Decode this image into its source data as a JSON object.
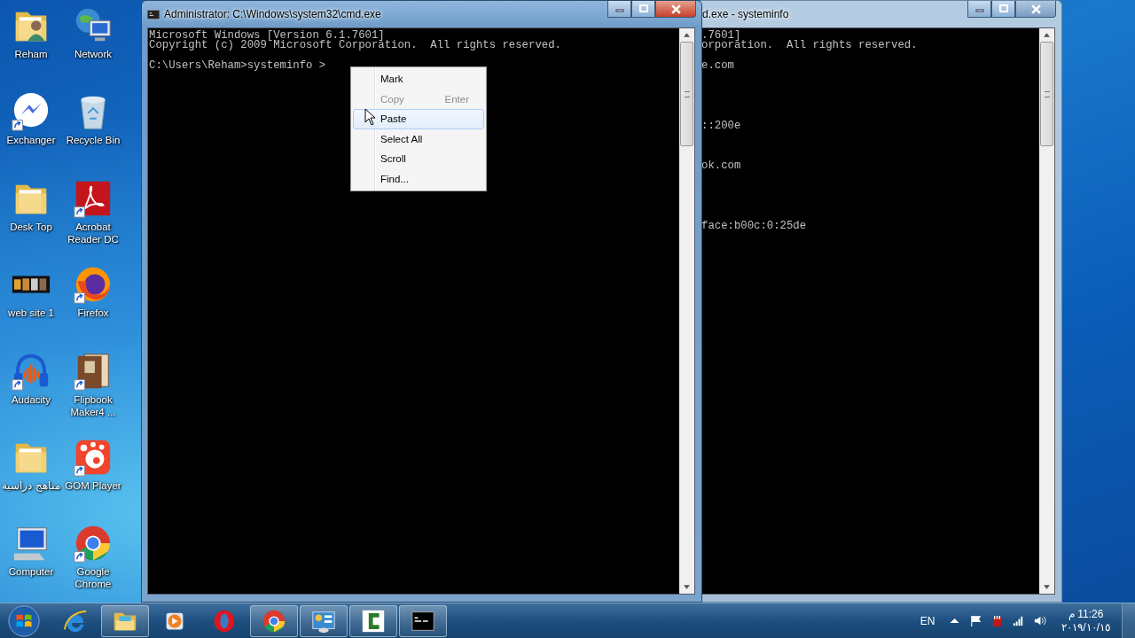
{
  "desktop_icons": [
    {
      "label": "Reham",
      "kind": "user-folder",
      "shortcut": false
    },
    {
      "label": "Network",
      "kind": "network",
      "shortcut": false
    },
    {
      "label": "Exchanger",
      "kind": "messenger",
      "shortcut": true
    },
    {
      "label": "Recycle Bin",
      "kind": "recycle-bin",
      "shortcut": false
    },
    {
      "label": "Desk Top",
      "kind": "folder",
      "shortcut": false
    },
    {
      "label": "Acrobat Reader DC",
      "kind": "acrobat",
      "shortcut": true
    },
    {
      "label": "web site 1",
      "kind": "website",
      "shortcut": false
    },
    {
      "label": "Firefox",
      "kind": "firefox",
      "shortcut": true
    },
    {
      "label": "Audacity",
      "kind": "audacity",
      "shortcut": true
    },
    {
      "label": "Flipbook Maker4 ...",
      "kind": "flipbook",
      "shortcut": true
    },
    {
      "label": "مناهج دراسية",
      "kind": "folder",
      "shortcut": false
    },
    {
      "label": "GOM Player",
      "kind": "gom",
      "shortcut": true
    },
    {
      "label": "Computer",
      "kind": "computer",
      "shortcut": false
    },
    {
      "label": "Google Chrome",
      "kind": "chrome",
      "shortcut": true
    }
  ],
  "windows": [
    {
      "title": "Administrator: C:\\Windows\\system32\\cmd.exe",
      "active": true,
      "lines": [
        {
          "kind": "text",
          "text": "Microsoft Windows [Version 6.1.7601]"
        },
        {
          "kind": "text",
          "text": "Copyright (c) 2009 Microsoft Corporation.  All rights reserved."
        },
        {
          "kind": "blank"
        },
        {
          "kind": "text",
          "text": "C:\\Users\\Reham>systeminfo >"
        }
      ]
    },
    {
      "title": "d.exe - systeminfo",
      "active": false,
      "lines": [
        {
          "kind": "text",
          "text": ".7601]"
        },
        {
          "kind": "text",
          "text": "orporation.  All rights reserved."
        },
        {
          "kind": "blank"
        },
        {
          "kind": "text",
          "text": "e.com"
        },
        {
          "kind": "blank"
        },
        {
          "kind": "blank"
        },
        {
          "kind": "blank"
        },
        {
          "kind": "blank"
        },
        {
          "kind": "blank"
        },
        {
          "kind": "text",
          "text": "::200e"
        },
        {
          "kind": "blank"
        },
        {
          "kind": "blank"
        },
        {
          "kind": "blank"
        },
        {
          "kind": "text",
          "text": "ok.com"
        },
        {
          "kind": "blank"
        },
        {
          "kind": "blank"
        },
        {
          "kind": "blank"
        },
        {
          "kind": "blank"
        },
        {
          "kind": "blank"
        },
        {
          "kind": "text",
          "text": "face:b00c:0:25de"
        }
      ]
    }
  ],
  "context_menu": {
    "items": [
      {
        "label": "Mark",
        "disabled": false,
        "selected": false
      },
      {
        "label": "Copy",
        "shortcut": "Enter",
        "disabled": true,
        "selected": false
      },
      {
        "label": "Paste",
        "disabled": false,
        "selected": true
      },
      {
        "label": "Select All",
        "disabled": false,
        "selected": false
      },
      {
        "label": "Scroll",
        "disabled": false,
        "selected": false
      },
      {
        "label": "Find...",
        "disabled": false,
        "selected": false
      }
    ]
  },
  "taskbar": {
    "buttons": [
      {
        "kind": "ie",
        "running": false
      },
      {
        "kind": "explorer",
        "running": true
      },
      {
        "kind": "media",
        "running": false
      },
      {
        "kind": "opera",
        "running": false
      },
      {
        "kind": "chrome",
        "running": true
      },
      {
        "kind": "control-panel",
        "running": true
      },
      {
        "kind": "camtasia",
        "running": true
      },
      {
        "kind": "cmd",
        "running": true
      }
    ],
    "language": "EN",
    "time": "11:26 م",
    "date": "٢٠١٩/١٠/١٥"
  }
}
